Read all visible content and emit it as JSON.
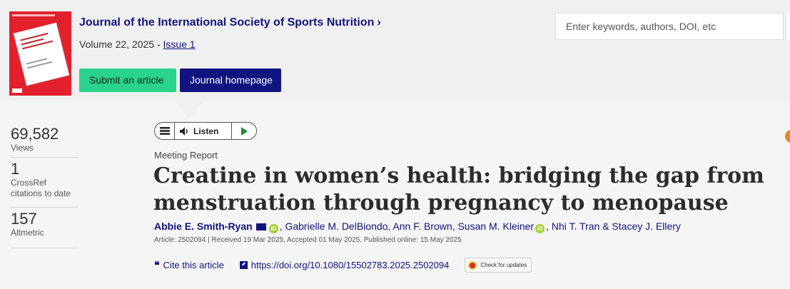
{
  "journal": {
    "name": "Journal of the International Society of Sports Nutrition",
    "chevron": "›",
    "volume_text": "Volume 22, 2025 - ",
    "issue_link": "Issue 1"
  },
  "buttons": {
    "submit": "Submit an article",
    "homepage": "Journal homepage"
  },
  "search": {
    "placeholder": "Enter keywords, authors, DOI, etc"
  },
  "metrics": [
    {
      "value": "69,582",
      "label": "Views"
    },
    {
      "value": "1",
      "label": "CrossRef citations to date"
    },
    {
      "value": "157",
      "label": "Altmetric"
    }
  ],
  "player": {
    "listen_label": "Listen",
    "menu_icon": "hamburger-icon",
    "speaker_icon": "speaker-icon",
    "play_icon": "play-icon"
  },
  "article": {
    "type": "Meeting Report",
    "title": "Creatine in women’s health: bridging the gap from menstruation through pregnancy to menopause",
    "authors": {
      "first": "Abbie E. Smith-Ryan",
      "second": ", Gabrielle M. DelBiondo, Ann F. Brown, Susan M. Kleiner",
      "third": ", Nhi T. Tran & Stacey J. Ellery"
    },
    "meta": "Article: 2502094 | Received 19 Mar 2025, Accepted 01 May 2025, Published online: 15 May 2025",
    "cite_label": "Cite this article",
    "doi": "https://doi.org/10.1080/15502783.2025.2502094",
    "check_updates": "Check for updates"
  },
  "colors": {
    "brand_navy": "#10147e",
    "submit_green": "#2ad38b",
    "cover_red": "#e3202d",
    "orcid_green": "#a6ce39"
  }
}
